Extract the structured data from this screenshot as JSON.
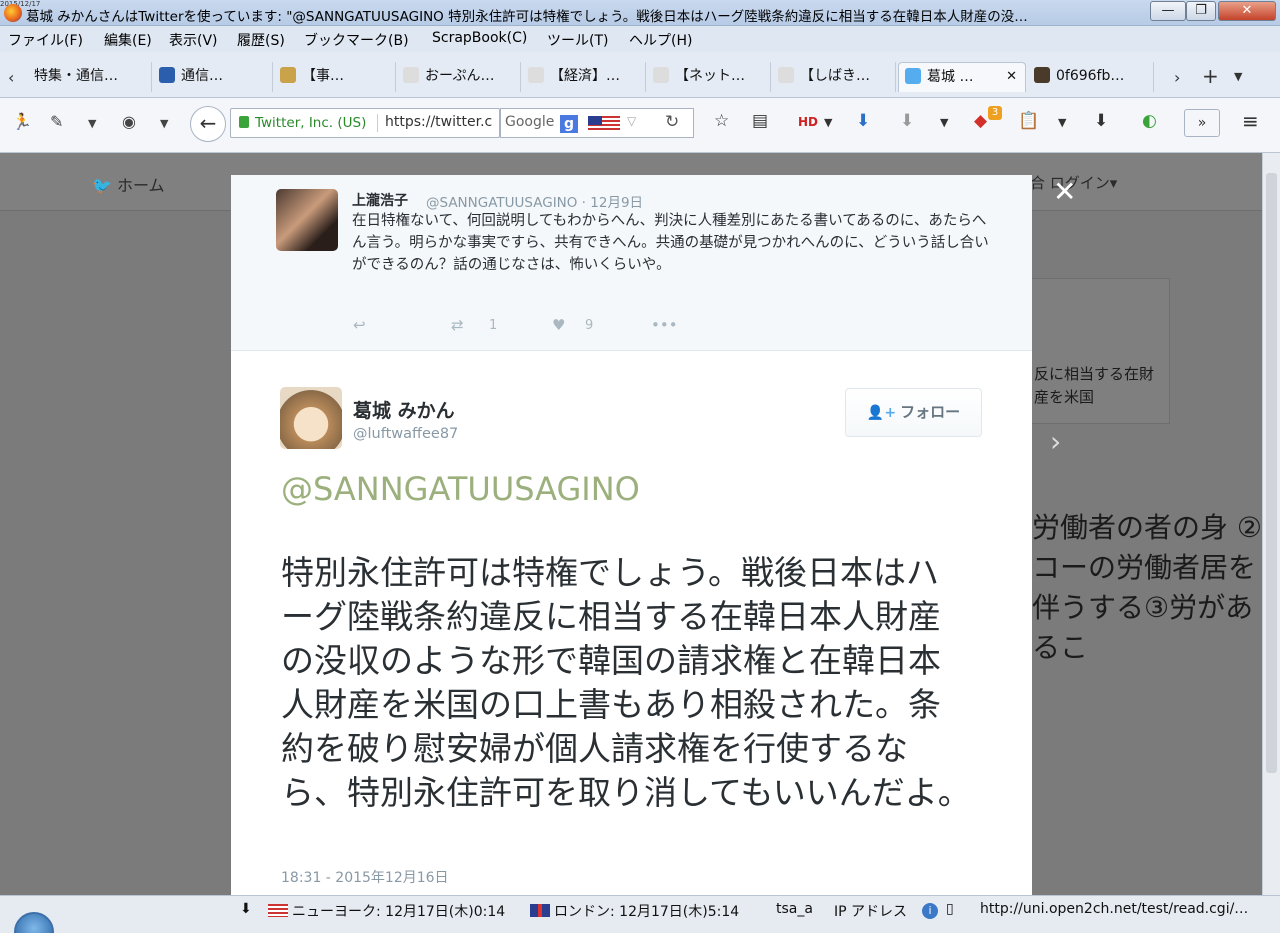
{
  "window": {
    "title": "葛城 みかんさんはTwitterを使っています: \"@SANNGATUUSAGINO 特別永住許可は特権でしょう。戦後日本はハーグ陸戦条約違反に相当する在韓日本人財産の没…",
    "date_stamp": "2015/12/17",
    "minimize": "—",
    "maximize": "❐",
    "close": "✕"
  },
  "menu": [
    "ファイル(F)",
    "編集(E)",
    "表示(V)",
    "履歴(S)",
    "ブックマーク(B)",
    "ScrapBook(C)",
    "ツール(T)",
    "ヘルプ(H)"
  ],
  "tabs": [
    {
      "label": "特集・通信…",
      "color": "#ffffff"
    },
    {
      "label": "通信…",
      "color": "#2b5fae"
    },
    {
      "label": "【事…",
      "color": "#c9a24a"
    },
    {
      "label": "おーぷん…",
      "color": "#dddddd"
    },
    {
      "label": "【経済】…",
      "color": "#dddddd"
    },
    {
      "label": "【ネット…",
      "color": "#dddddd"
    },
    {
      "label": "【しばき…",
      "color": "#dddddd"
    },
    {
      "label": "葛城 …",
      "color": "#55acee"
    },
    {
      "label": "0f696fb…",
      "color": "#4a3a2a"
    }
  ],
  "navbar": {
    "identity": "Twitter, Inc. (US)",
    "url": "https://twitter.c",
    "search_engine": "Google",
    "hd_label": "HD",
    "badge_count": "3"
  },
  "page": {
    "home": "ホーム",
    "login": "合 ログイン▾",
    "side_text": "反に相当する在財産を米国",
    "big_text": "労働者の者の身 ②コーの労働者居を伴うする③労があるこ"
  },
  "context_tweet": {
    "name": "上瀧浩子",
    "handle": "@SANNGATUUSAGINO · 12月9日",
    "text": "在日特権ないて、何回説明してもわからへん、判決に人種差別にあたる書いてあるのに、あたらへん言う。明らかな事実ですら、共有できへん。共通の基礎が見つかれへんのに、どういう話し合いができるのん？話の通じなさは、怖いくらいや。",
    "retweets": "1",
    "likes": "9"
  },
  "main_tweet": {
    "name": "葛城 みかん",
    "handle": "@luftwaffee87",
    "follow_label": "フォロー",
    "mention": "@SANNGATUUSAGINO",
    "text": "特別永住許可は特権でしょう。戦後日本はハーグ陸戦条約違反に相当する在韓日本人財産の没収のような形で韓国の請求権と在韓日本人財産を米国の口上書もあり相殺された。条約を破り慰安婦が個人請求権を行使するなら、特別永住許可を取り消してもいいんだよ。",
    "timestamp": "18:31 - 2015年12月16日"
  },
  "statusbar": {
    "ny": "ニューヨーク: 12月17日(木)0:14",
    "london": "ロンドン: 12月17日(木)5:14",
    "user": "tsa_a",
    "ip": "IP アドレス",
    "url": "http://uni.open2ch.net/test/read.cgi/…"
  }
}
